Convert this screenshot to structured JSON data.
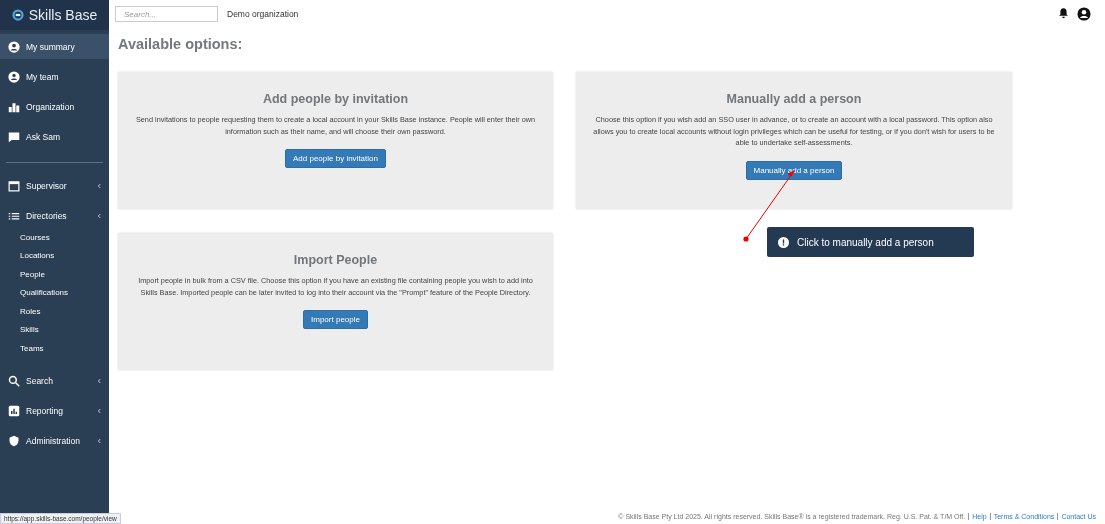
{
  "brand": {
    "name": "Skills Base"
  },
  "sidebar": {
    "items": [
      {
        "label": "My summary",
        "selected": true
      },
      {
        "label": "My team",
        "selected": false
      },
      {
        "label": "Organization",
        "selected": false
      },
      {
        "label": "Ask Sam",
        "selected": false,
        "divider_after": true
      },
      {
        "label": "Supervisor",
        "selected": false,
        "collapsible": true
      },
      {
        "label": "Directories",
        "selected": false,
        "collapsible": true,
        "children": [
          {
            "label": "Courses"
          },
          {
            "label": "Locations"
          },
          {
            "label": "People"
          },
          {
            "label": "Qualifications"
          },
          {
            "label": "Roles"
          },
          {
            "label": "Skills"
          },
          {
            "label": "Teams"
          }
        ]
      },
      {
        "label": "Search",
        "selected": false,
        "collapsible": true
      },
      {
        "label": "Reporting",
        "selected": false,
        "collapsible": true
      },
      {
        "label": "Administration",
        "selected": false,
        "collapsible": true
      }
    ]
  },
  "header": {
    "search": {
      "placeholder": "Search..."
    },
    "organization": "Demo organization"
  },
  "page_title": "Available options:",
  "cards": [
    {
      "title": "Add people by invitation",
      "text": "Send invitations to people requesting them to create a local account in your Skills Base instance. People will enter their own information such as their name, and will choose their own password.",
      "button": "Add people by invitation"
    },
    {
      "title": "Manually add a person",
      "text": "Choose this option if you wish add an SSO user in advance, or to create an account with a local password. This option also allows you to create local accounts without login privileges which can be useful for testing, or if you don't wish for users to be able to undertake self-assessments.",
      "button": "Manually add a person"
    },
    {
      "title": "Import People",
      "text": "Import people in bulk from a CSV file. Choose this option if you have an existing file containing people you wish to add into Skills Base. Imported people can be later invited to log into their account via the \"Prompt\" feature of the People Directory.",
      "button": "Import people"
    }
  ],
  "callout": {
    "text": "Click to manually add a person"
  },
  "footer": {
    "text": "© Skills Base Pty Ltd 2025. All rights reserved. Skills Base® is a registered trademark. Reg. U.S. Pat. & T/M Off.",
    "links": [
      "Help",
      "Terms & Conditions",
      "Contact Us"
    ]
  },
  "status_url": "https://app.skills-base.com/people/view"
}
